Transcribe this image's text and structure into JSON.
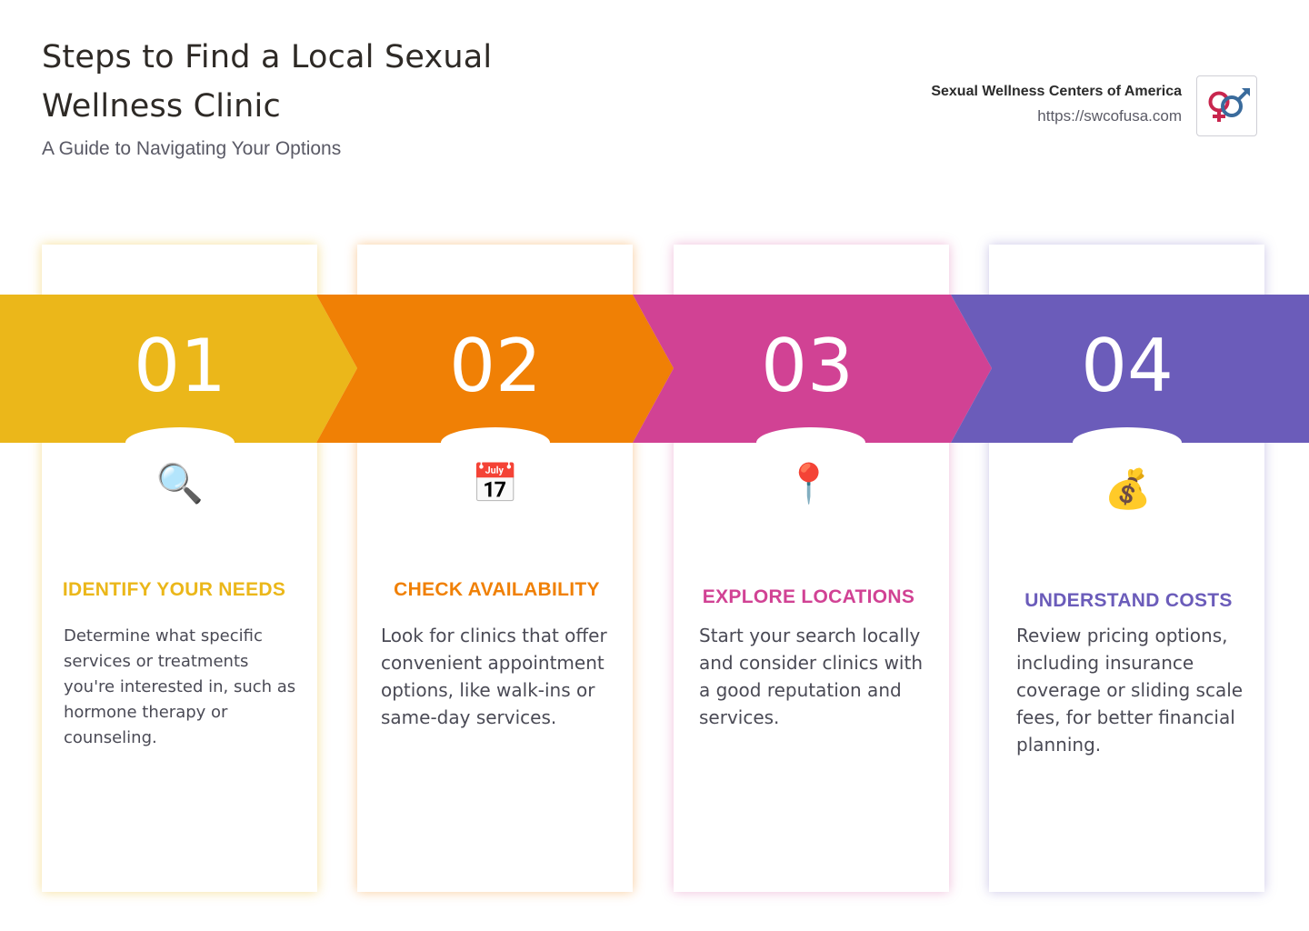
{
  "header": {
    "title": "Steps to Find a Local Sexual Wellness Clinic",
    "subtitle": "A Guide to Navigating Your Options"
  },
  "brand": {
    "name": "Sexual Wellness Centers of America",
    "url": "https://swcofusa.com",
    "logo_icon": "gender-symbols-icon"
  },
  "steps": [
    {
      "number": "01",
      "icon": "magnifying-glass-icon",
      "glyph": "🔍",
      "title": "IDENTIFY YOUR NEEDS",
      "description": "Determine what specific services or treatments you're interested in, such as hormone therapy or counseling.",
      "color": "#EBB71A"
    },
    {
      "number": "02",
      "icon": "calendar-icon",
      "glyph": "📅",
      "title": "CHECK AVAILABILITY",
      "description": "Look for clinics that offer convenient appointment options, like walk-ins or same-day services.",
      "color": "#F08005"
    },
    {
      "number": "03",
      "icon": "pushpin-icon",
      "glyph": "📍",
      "title": "EXPLORE LOCATIONS",
      "description": "Start your search locally and consider clinics with a good reputation and services.",
      "color": "#D14294"
    },
    {
      "number": "04",
      "icon": "money-bag-icon",
      "glyph": "💰",
      "title": "UNDERSTAND COSTS",
      "description": "Review pricing options, including insurance coverage or sliding scale fees, for better financial planning.",
      "color": "#6B5CBA"
    }
  ]
}
